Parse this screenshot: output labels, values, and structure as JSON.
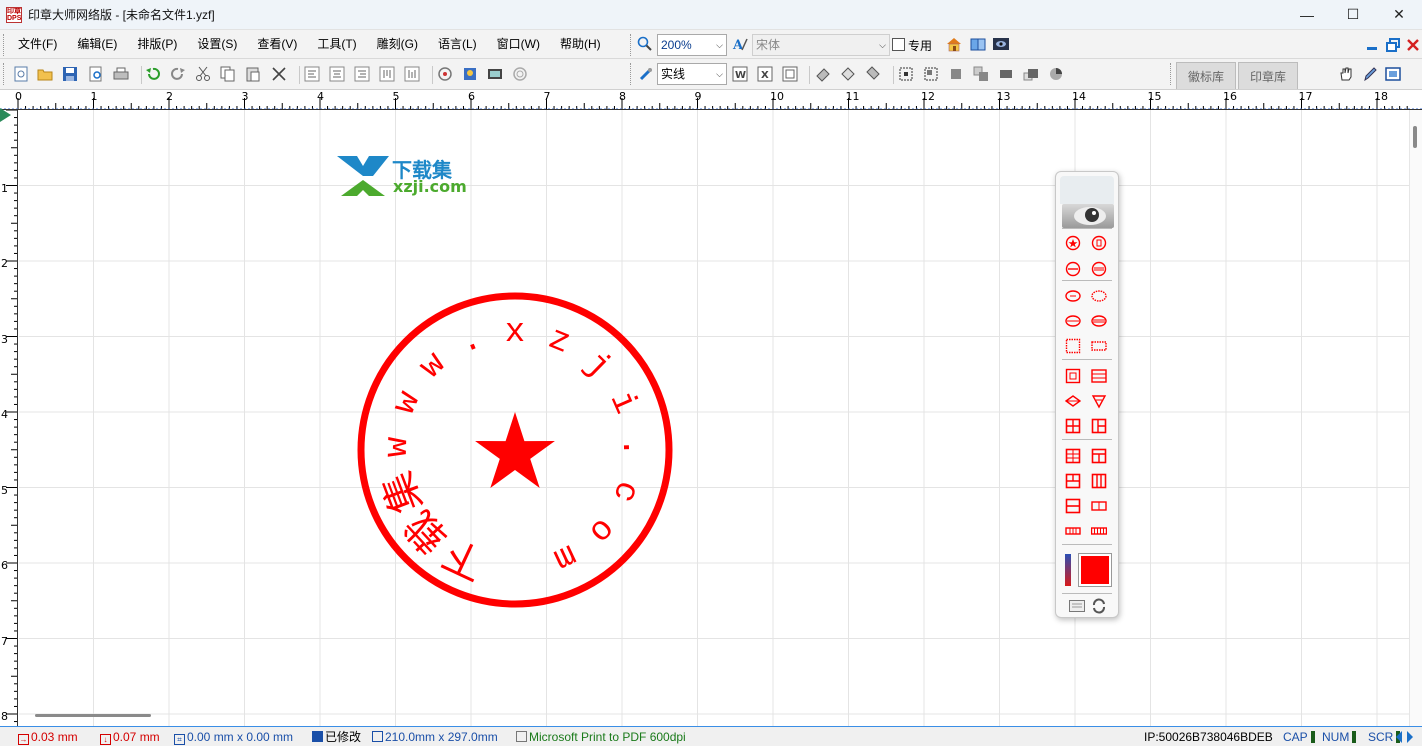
{
  "window": {
    "title": "印章大师网络版 - [未命名文件1.yzf]",
    "app_icon_text": "印章\nDPS",
    "controls": {
      "minimize": "—",
      "maximize": "☐",
      "close": "✕"
    }
  },
  "menu": {
    "items": [
      "文件(F)",
      "编辑(E)",
      "排版(P)",
      "设置(S)",
      "查看(V)",
      "工具(T)",
      "雕刻(G)",
      "语言(L)",
      "窗口(W)",
      "帮助(H)"
    ]
  },
  "format_bar": {
    "zoom_value": "200%",
    "font_value": "宋体",
    "special_checkbox_label": "专用",
    "special_checked": false
  },
  "toolbar": {
    "line_style_value": "实线",
    "tabs": [
      "徽标库",
      "印章库"
    ]
  },
  "ruler": {
    "h_labels": [
      "0",
      "1",
      "2",
      "3",
      "4",
      "5",
      "6",
      "7",
      "8",
      "9",
      "10",
      "11",
      "12",
      "13",
      "14",
      "15",
      "16",
      "17",
      "18"
    ],
    "v_labels": [
      "1",
      "2",
      "3",
      "4",
      "5",
      "6",
      "7",
      "8"
    ]
  },
  "watermark": {
    "cn_text": "下载集",
    "en_text": "xzji.com"
  },
  "stamp": {
    "ring_text": "下载集www.xzji.com",
    "color": "#ff0000"
  },
  "palette": {
    "current_color": "#ff0000"
  },
  "status": {
    "offset_x": "0.03 mm",
    "offset_y": "0.07 mm",
    "selection_size": "0.00 mm x 0.00 mm",
    "modified": "已修改",
    "page_size": "210.0mm x 297.0mm",
    "printer": "Microsoft Print to PDF 600dpi",
    "ip": "IP:50026B738046BDEB",
    "cap": "CAP",
    "num": "NUM",
    "scr": "SCR"
  },
  "colors": {
    "stamp_red": "#ff0000",
    "status_red": "#d40000",
    "status_blue": "#1a4fa8",
    "status_green": "#1a7a1a"
  }
}
